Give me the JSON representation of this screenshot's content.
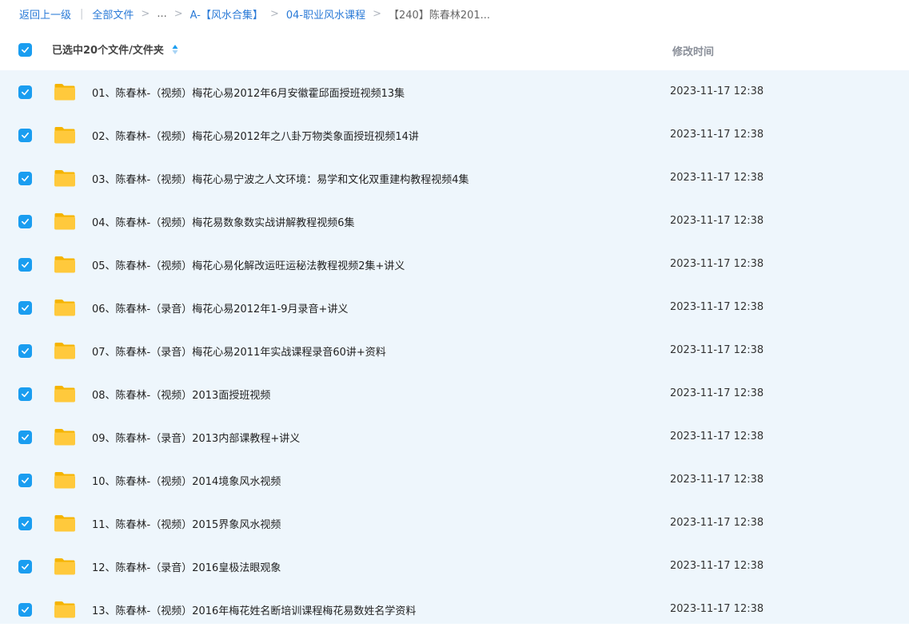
{
  "breadcrumb": {
    "back": "返回上一级",
    "all_files": "全部文件",
    "ellipsis": "...",
    "level1": "A-【风水合集】",
    "level2": "04-职业风水课程",
    "current": "【240】陈春林201..."
  },
  "header": {
    "selection_label": "已选中20个文件/文件夹",
    "time_column": "修改时间"
  },
  "files": [
    {
      "name": "01、陈春林-（视频）梅花心易2012年6月安徽霍邱面授班视频13集",
      "time": "2023-11-17 12:38"
    },
    {
      "name": "02、陈春林-（视频）梅花心易2012年之八卦万物类象面授班视频14讲",
      "time": "2023-11-17 12:38"
    },
    {
      "name": "03、陈春林-（视频）梅花心易宁波之人文环境：易学和文化双重建构教程视频4集",
      "time": "2023-11-17 12:38"
    },
    {
      "name": "04、陈春林-（视频）梅花易数象数实战讲解教程视频6集",
      "time": "2023-11-17 12:38"
    },
    {
      "name": "05、陈春林-（视频）梅花心易化解改运旺运秘法教程视频2集+讲义",
      "time": "2023-11-17 12:38"
    },
    {
      "name": "06、陈春林-（录音）梅花心易2012年1-9月录音+讲义",
      "time": "2023-11-17 12:38"
    },
    {
      "name": "07、陈春林-（录音）梅花心易2011年实战课程录音60讲+资料",
      "time": "2023-11-17 12:38"
    },
    {
      "name": "08、陈春林-（视频）2013面授班视频",
      "time": "2023-11-17 12:38"
    },
    {
      "name": "09、陈春林-（录音）2013内部课教程+讲义",
      "time": "2023-11-17 12:38"
    },
    {
      "name": "10、陈春林-（视频）2014境象风水视频",
      "time": "2023-11-17 12:38"
    },
    {
      "name": "11、陈春林-（视频）2015界象风水视频",
      "time": "2023-11-17 12:38"
    },
    {
      "name": "12、陈春林-（录音）2016皇极法眼观象",
      "time": "2023-11-17 12:38"
    },
    {
      "name": "13、陈春林-（视频）2016年梅花姓名断培训课程梅花易数姓名学资料",
      "time": "2023-11-17 12:38"
    }
  ],
  "colors": {
    "accent": "#1a9df0",
    "link": "#2a7ad7",
    "list_background": "#eef6fc",
    "folder": "#ffc93c"
  },
  "icons": {
    "checkbox": "checkbox-checked-icon",
    "folder": "folder-icon",
    "sort": "sort-icon"
  }
}
